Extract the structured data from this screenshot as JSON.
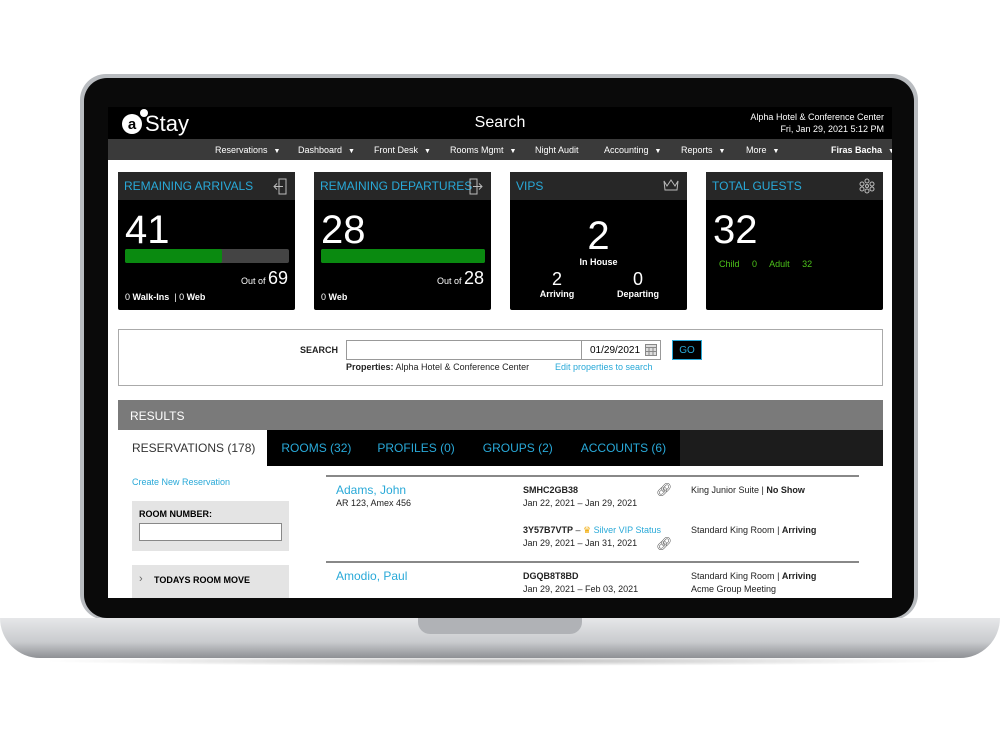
{
  "header": {
    "app_name": "Stay",
    "title": "Search",
    "property": "Alpha Hotel & Conference Center",
    "datetime": "Fri, Jan 29, 2021 5:12 PM"
  },
  "nav": {
    "items": [
      "Reservations",
      "Dashboard",
      "Front Desk",
      "Rooms Mgmt",
      "Night Audit",
      "Accounting",
      "Reports",
      "More"
    ],
    "user": "Firas Bacha"
  },
  "cards": {
    "arrivals": {
      "title": "REMAINING ARRIVALS",
      "value": "41",
      "out_of_label": "Out of",
      "total": "69",
      "progress_fraction": 0.594,
      "walkins": "0",
      "walkins_label": "Walk-Ins",
      "web": "0",
      "web_label": "Web"
    },
    "departures": {
      "title": "REMAINING DEPARTURES",
      "value": "28",
      "out_of_label": "Out of",
      "total": "28",
      "progress_fraction": 1.0,
      "web": "0",
      "web_label": "Web"
    },
    "vips": {
      "title": "VIPS",
      "in_house": "2",
      "in_house_label": "In House",
      "arriving": "2",
      "arriving_label": "Arriving",
      "departing": "0",
      "departing_label": "Departing"
    },
    "guests": {
      "title": "TOTAL GUESTS",
      "value": "32",
      "child_label": "Child",
      "child": "0",
      "adult_label": "Adult",
      "adult": "32"
    }
  },
  "search": {
    "label": "SEARCH",
    "value": "",
    "date": "01/29/2021",
    "go": "GO",
    "properties_label": "Properties:",
    "properties": "Alpha Hotel & Conference Center",
    "edit_link": "Edit properties to search"
  },
  "results": {
    "title": "RESULTS",
    "tabs": [
      "RESERVATIONS (178)",
      "ROOMS (32)",
      "PROFILES (0)",
      "GROUPS (2)",
      "ACCOUNTS (6)"
    ],
    "create_link": "Create New Reservation",
    "room_number_label": "ROOM NUMBER:",
    "room_number_value": "",
    "todays_move": "TODAYS ROOM MOVE",
    "rows": [
      {
        "name": "Adams, John",
        "sub": "AR 123, Amex 456",
        "res": [
          {
            "code": "SMHC2GB38",
            "dates": "Jan 22, 2021 – Jan 29, 2021",
            "room": "King Junior Suite",
            "status": "No Show"
          },
          {
            "code": "3Y57B7VTP",
            "vip": "Silver VIP Status",
            "dates": "Jan 29, 2021 – Jan 31, 2021",
            "room": "Standard King Room",
            "status": "Arriving"
          }
        ]
      },
      {
        "name": "Amodio, Paul",
        "res": [
          {
            "code": "DGQB8T8BD",
            "dates": "Jan 29, 2021 – Feb 03, 2021",
            "room": "Standard King Room",
            "status": "Arriving",
            "group": "Acme Group Meeting"
          }
        ]
      }
    ]
  },
  "colors": {
    "accent": "#29a9d8",
    "progress": "#0a8a10",
    "guests_green": "#4cc21a",
    "vip_gold": "#f0a800"
  }
}
